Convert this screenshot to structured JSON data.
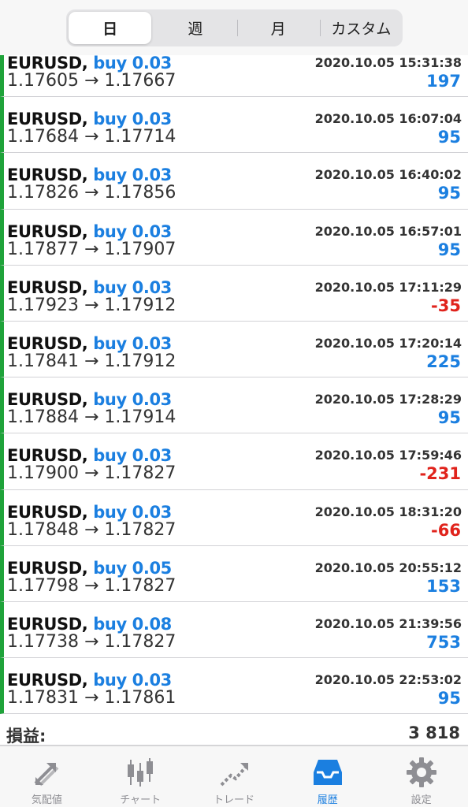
{
  "header": {
    "tabs": [
      {
        "label": "日",
        "active": true
      },
      {
        "label": "週",
        "active": false
      },
      {
        "label": "月",
        "active": false
      },
      {
        "label": "カスタム",
        "active": false
      }
    ]
  },
  "trades": [
    {
      "symbol": "EURUSD,",
      "side": "buy 0.03",
      "time": "2020.10.05 15:31:38",
      "open": "1.17605",
      "close": "1.17667",
      "profit": "197",
      "negative": false
    },
    {
      "symbol": "EURUSD,",
      "side": "buy 0.03",
      "time": "2020.10.05 16:07:04",
      "open": "1.17684",
      "close": "1.17714",
      "profit": "95",
      "negative": false
    },
    {
      "symbol": "EURUSD,",
      "side": "buy 0.03",
      "time": "2020.10.05 16:40:02",
      "open": "1.17826",
      "close": "1.17856",
      "profit": "95",
      "negative": false
    },
    {
      "symbol": "EURUSD,",
      "side": "buy 0.03",
      "time": "2020.10.05 16:57:01",
      "open": "1.17877",
      "close": "1.17907",
      "profit": "95",
      "negative": false
    },
    {
      "symbol": "EURUSD,",
      "side": "buy 0.03",
      "time": "2020.10.05 17:11:29",
      "open": "1.17923",
      "close": "1.17912",
      "profit": "-35",
      "negative": true
    },
    {
      "symbol": "EURUSD,",
      "side": "buy 0.03",
      "time": "2020.10.05 17:20:14",
      "open": "1.17841",
      "close": "1.17912",
      "profit": "225",
      "negative": false
    },
    {
      "symbol": "EURUSD,",
      "side": "buy 0.03",
      "time": "2020.10.05 17:28:29",
      "open": "1.17884",
      "close": "1.17914",
      "profit": "95",
      "negative": false
    },
    {
      "symbol": "EURUSD,",
      "side": "buy 0.03",
      "time": "2020.10.05 17:59:46",
      "open": "1.17900",
      "close": "1.17827",
      "profit": "-231",
      "negative": true
    },
    {
      "symbol": "EURUSD,",
      "side": "buy 0.03",
      "time": "2020.10.05 18:31:20",
      "open": "1.17848",
      "close": "1.17827",
      "profit": "-66",
      "negative": true
    },
    {
      "symbol": "EURUSD,",
      "side": "buy 0.05",
      "time": "2020.10.05 20:55:12",
      "open": "1.17798",
      "close": "1.17827",
      "profit": "153",
      "negative": false
    },
    {
      "symbol": "EURUSD,",
      "side": "buy 0.08",
      "time": "2020.10.05 21:39:56",
      "open": "1.17738",
      "close": "1.17827",
      "profit": "753",
      "negative": false
    },
    {
      "symbol": "EURUSD,",
      "side": "buy 0.03",
      "time": "2020.10.05 22:53:02",
      "open": "1.17831",
      "close": "1.17861",
      "profit": "95",
      "negative": false
    }
  ],
  "arrow": "→",
  "summary": {
    "label": "損益:",
    "value": "3 818"
  },
  "tabbar": {
    "items": [
      {
        "label": "気配値",
        "icon": "quotes-icon",
        "active": false
      },
      {
        "label": "チャート",
        "icon": "chart-icon",
        "active": false
      },
      {
        "label": "トレード",
        "icon": "trade-icon",
        "active": false
      },
      {
        "label": "履歴",
        "icon": "history-icon",
        "active": true
      },
      {
        "label": "設定",
        "icon": "settings-icon",
        "active": false
      }
    ]
  },
  "colors": {
    "accent": "#1b7fe0",
    "loss": "#e0231c",
    "profit_bar": "#1fa33a",
    "inactive": "#8e8e93"
  }
}
